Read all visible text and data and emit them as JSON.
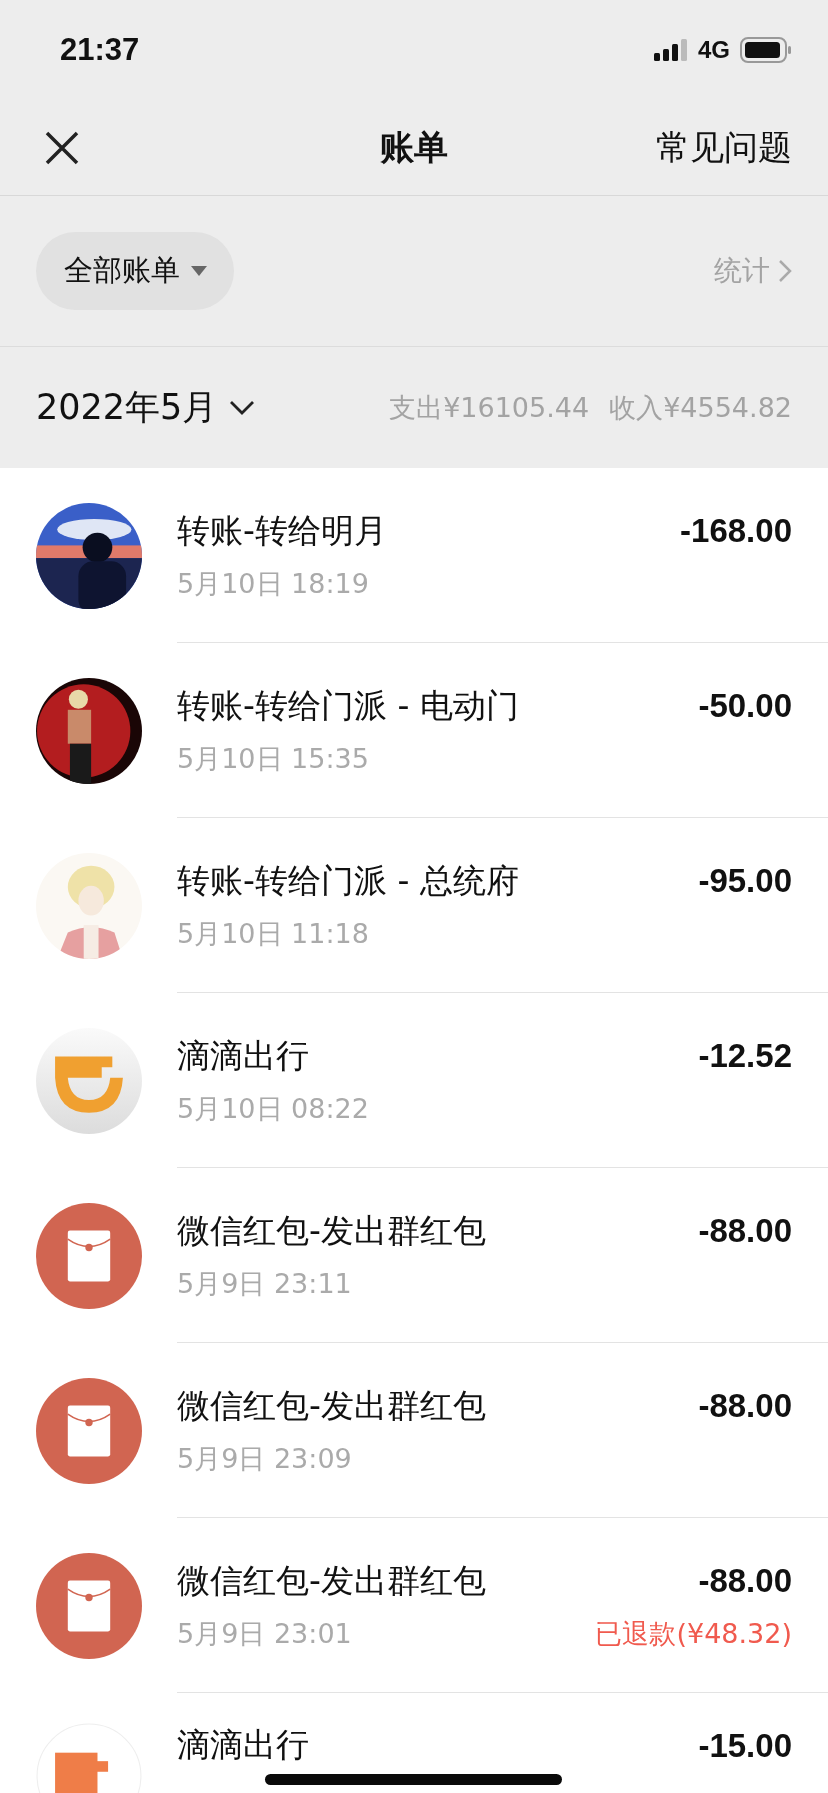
{
  "status_bar": {
    "time": "21:37",
    "network": "4G"
  },
  "nav": {
    "title": "账单",
    "action": "常见问题"
  },
  "filter": {
    "label": "全部账单",
    "stats": "统计"
  },
  "month": {
    "label": "2022年5月",
    "expense": "支出¥16105.44",
    "income": "收入¥4554.82"
  },
  "transactions": [
    {
      "kind": "photo-sea",
      "title": "转账-转给明月",
      "time": "5月10日 18:19",
      "amount": "-168.00"
    },
    {
      "kind": "photo-red",
      "title": "转账-转给门派 - 电动门",
      "time": "5月10日 15:35",
      "amount": "-50.00"
    },
    {
      "kind": "photo-light",
      "title": "转账-转给门派 - 总统府",
      "time": "5月10日 11:18",
      "amount": "-95.00"
    },
    {
      "kind": "ride-logo",
      "title": "滴滴出行",
      "time": "5月10日 08:22",
      "amount": "-12.52"
    },
    {
      "kind": "red-packet",
      "title": "微信红包-发出群红包",
      "time": "5月9日 23:11",
      "amount": "-88.00"
    },
    {
      "kind": "red-packet",
      "title": "微信红包-发出群红包",
      "time": "5月9日 23:09",
      "amount": "-88.00"
    },
    {
      "kind": "red-packet",
      "title": "微信红包-发出群红包",
      "time": "5月9日 23:01",
      "amount": "-88.00",
      "note": "已退款(¥48.32)"
    },
    {
      "kind": "orange-logo",
      "title": "滴滴出行",
      "amount": "-15.00"
    }
  ]
}
